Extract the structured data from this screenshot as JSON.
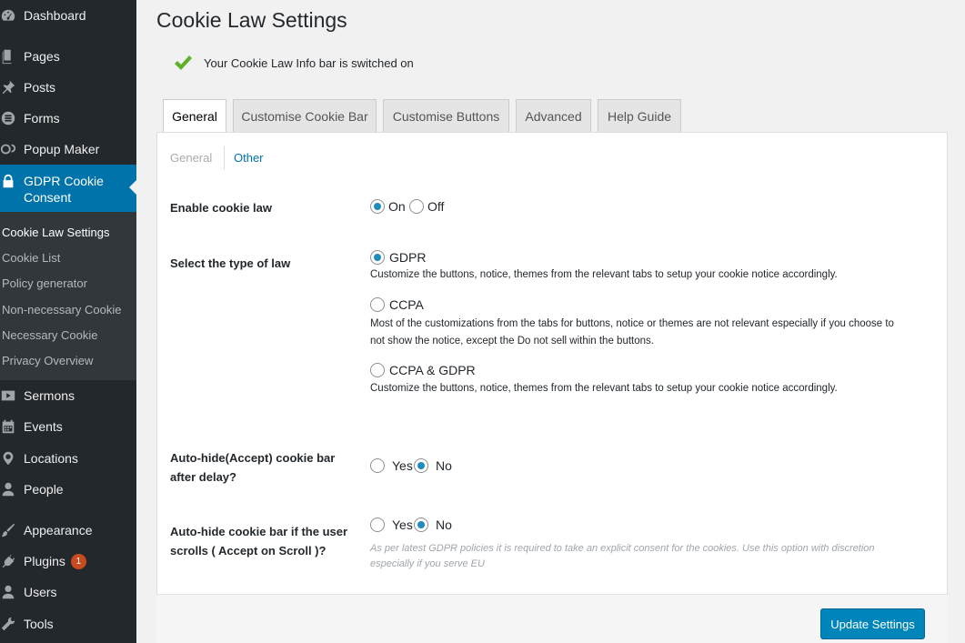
{
  "sidebar": {
    "menu": [
      {
        "label": "Dashboard",
        "icon": "dashboard-icon"
      },
      {
        "label": "Pages",
        "icon": "pages-icon"
      },
      {
        "label": "Posts",
        "icon": "pin-icon"
      },
      {
        "label": "Forms",
        "icon": "forms-icon"
      },
      {
        "label": "Popup Maker",
        "icon": "popup-icon"
      },
      {
        "label": "GDPR Cookie Consent",
        "icon": "lock-icon"
      },
      {
        "label": "Sermons",
        "icon": "video-icon"
      },
      {
        "label": "Events",
        "icon": "calendar-icon"
      },
      {
        "label": "Locations",
        "icon": "location-icon"
      },
      {
        "label": "People",
        "icon": "person-icon"
      },
      {
        "label": "Appearance",
        "icon": "brush-icon"
      },
      {
        "label": "Plugins",
        "icon": "plug-icon",
        "badge": "1"
      },
      {
        "label": "Users",
        "icon": "users-icon"
      },
      {
        "label": "Tools",
        "icon": "wrench-icon"
      }
    ],
    "submenu": [
      "Cookie Law Settings",
      "Cookie List",
      "Policy generator",
      "Non-necessary Cookie",
      "Necessary Cookie",
      "Privacy Overview"
    ]
  },
  "page": {
    "title": "Cookie Law Settings",
    "notice": "Your Cookie Law Info bar is switched on"
  },
  "tabs": [
    "General",
    "Customise Cookie Bar",
    "Customise Buttons",
    "Advanced",
    "Help Guide"
  ],
  "subtabs": [
    "General",
    "Other"
  ],
  "settings": {
    "enable": {
      "label": "Enable cookie law",
      "on": "On",
      "off": "Off",
      "selected": "On"
    },
    "law_type": {
      "label": "Select the type of law",
      "selected": "GDPR",
      "options": [
        {
          "label": "GDPR",
          "desc": "Customize the buttons, notice, themes from the relevant tabs to setup your cookie notice accordingly."
        },
        {
          "label": "CCPA",
          "desc1": "Most of the customizations from the tabs for buttons, notice or themes are not relevant especially if you choose to",
          "desc2": "not show the notice, except the Do not sell within the buttons."
        },
        {
          "label": "CCPA & GDPR",
          "desc": "Customize the buttons, notice, themes from the relevant tabs to setup your cookie notice accordingly."
        }
      ]
    },
    "autohide_delay": {
      "label1": "Auto-hide(Accept) cookie bar",
      "label2": "after delay?",
      "yes": "Yes",
      "no": "No",
      "selected": "No"
    },
    "autohide_scroll": {
      "label1": "Auto-hide cookie bar if the user",
      "label2": "scrolls ( Accept on Scroll )?",
      "yes": "Yes",
      "no": "No",
      "selected": "No",
      "note1": "As per latest GDPR policies it is required to take an explicit consent for the cookies. Use this option with discretion",
      "note2": "especially if you serve EU"
    }
  },
  "update_button": "Update Settings",
  "colors": {
    "sidebar_bg": "#23282d",
    "active_menu": "#0073aa",
    "button": "#0085ba",
    "link": "#0073aa",
    "check": "#5fb12a"
  }
}
